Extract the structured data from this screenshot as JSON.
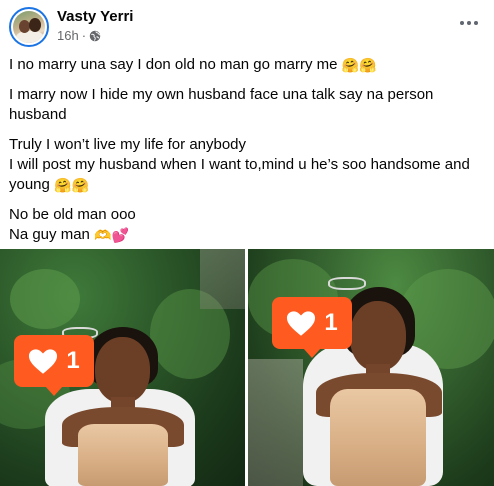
{
  "post": {
    "author": "Vasty Yerri",
    "time": "16h",
    "separator": "·",
    "paragraphs": [
      {
        "text": "I no marry una say I don old no man go marry me",
        "emoji": "🤗🤗"
      },
      {
        "text": "I marry now I hide my own husband face una talk say na person husband",
        "emoji": ""
      }
    ],
    "paragraph3_line1": "Truly I won’t live my life for anybody",
    "paragraph3_line2": "I will post my husband when I want to,mind u he’s soo handsome and young",
    "paragraph3_emoji": "🤗🤗",
    "paragraph4_line1": "No be old man ooo",
    "paragraph4_line2": "Na guy man",
    "paragraph4_emoji": "🫶💕"
  },
  "photos": [
    {
      "badge_count": "1",
      "accent": "#ff5a1f"
    },
    {
      "badge_count": "1",
      "accent": "#ff5a1f"
    }
  ],
  "icons": {
    "globe": "globe-icon",
    "more": "more-horizontal-icon",
    "heart": "heart-icon"
  }
}
